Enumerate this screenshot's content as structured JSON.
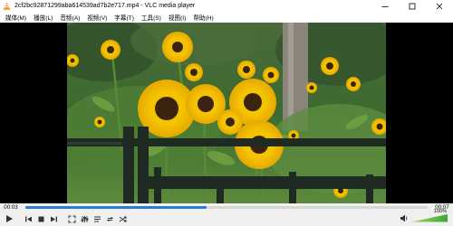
{
  "window": {
    "title": "2cf2bc92871299aba614539ad7b2e717.mp4 - VLC media player",
    "icons": {
      "app": "vlc-cone-icon",
      "minimize": "minimize-icon",
      "maximize": "maximize-icon",
      "close": "close-icon"
    }
  },
  "menu": {
    "items": [
      {
        "label": "媒体(M)"
      },
      {
        "label": "播放(L)"
      },
      {
        "label": "音频(A)"
      },
      {
        "label": "视频(V)"
      },
      {
        "label": "字幕(T)"
      },
      {
        "label": "工具(S)"
      },
      {
        "label": "视图(I)"
      },
      {
        "label": "帮助(H)"
      }
    ]
  },
  "player": {
    "elapsed": "00:03",
    "duration": "00:07",
    "progress_percent": 45,
    "volume_label": "100%",
    "volume_percent": 100,
    "accent_color": "#2c7bd6",
    "controls": [
      "play-icon",
      "previous-icon",
      "stop-icon",
      "next-icon",
      "fullscreen-icon",
      "extended-settings-icon",
      "playlist-icon",
      "loop-icon",
      "shuffle-icon",
      "volume-icon"
    ]
  }
}
